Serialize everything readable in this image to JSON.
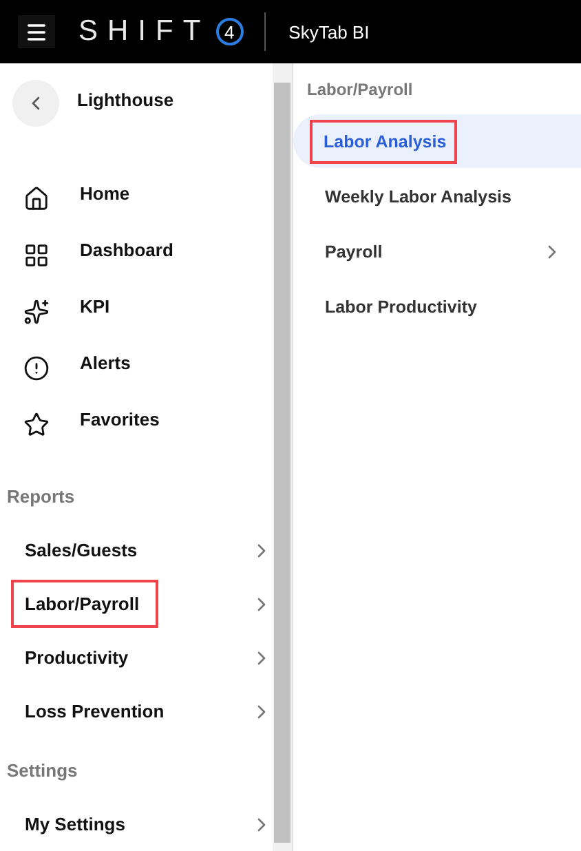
{
  "header": {
    "logo_text": "SHIFT",
    "logo_digit": "4",
    "app_name": "SkyTab BI"
  },
  "sidebar": {
    "title": "Lighthouse",
    "nav": [
      {
        "label": "Home",
        "kind": "home"
      },
      {
        "label": "Dashboard",
        "kind": "dashboard"
      },
      {
        "label": "KPI",
        "kind": "kpi"
      },
      {
        "label": "Alerts",
        "kind": "alerts"
      },
      {
        "label": "Favorites",
        "kind": "favorites"
      }
    ],
    "sections": [
      {
        "heading": "Reports",
        "items": [
          {
            "label": "Sales/Guests",
            "highlighted": false
          },
          {
            "label": "Labor/Payroll",
            "highlighted": true
          },
          {
            "label": "Productivity",
            "highlighted": false
          },
          {
            "label": "Loss Prevention",
            "highlighted": false
          }
        ]
      },
      {
        "heading": "Settings",
        "items": [
          {
            "label": "My Settings",
            "highlighted": false
          }
        ]
      }
    ]
  },
  "submenu": {
    "heading": "Labor/Payroll",
    "items": [
      {
        "label": "Labor Analysis",
        "selected": true,
        "highlighted": true,
        "has_children": false
      },
      {
        "label": "Weekly Labor Analysis",
        "selected": false,
        "highlighted": false,
        "has_children": false
      },
      {
        "label": "Payroll",
        "selected": false,
        "highlighted": false,
        "has_children": true
      },
      {
        "label": "Labor Productivity",
        "selected": false,
        "highlighted": false,
        "has_children": false
      }
    ]
  }
}
